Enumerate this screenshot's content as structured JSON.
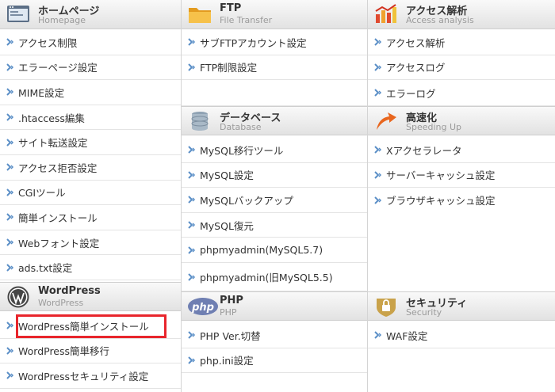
{
  "columns": [
    {
      "sections": [
        {
          "title": "ホームページ",
          "subtitle": "Homepage",
          "icon": "homepage-icon",
          "items": [
            "アクセス制限",
            "エラーページ設定",
            "MIME設定",
            ".htaccess編集",
            "サイト転送設定",
            "アクセス拒否設定",
            "CGIツール",
            "簡単インストール",
            "Webフォント設定",
            "ads.txt設定"
          ]
        },
        {
          "title": "WordPress",
          "subtitle": "WordPress",
          "icon": "wordpress-icon",
          "items": [
            "WordPress簡単インストール",
            "WordPress簡単移行",
            "WordPressセキュリティ設定"
          ]
        }
      ]
    },
    {
      "sections": [
        {
          "title": "FTP",
          "subtitle": "File Transfer",
          "icon": "folder-icon",
          "items": [
            "サブFTPアカウント設定",
            "FTP制限設定"
          ]
        },
        {
          "title": "データベース",
          "subtitle": "Database",
          "icon": "database-icon",
          "items": [
            "MySQL移行ツール",
            "MySQL設定",
            "MySQLバックアップ",
            "MySQL復元",
            "phpmyadmin(MySQL5.7)",
            "phpmyadmin(旧MySQL5.5)"
          ]
        },
        {
          "title": "PHP",
          "subtitle": "PHP",
          "icon": "php-icon",
          "items": [
            "PHP Ver.切替",
            "php.ini設定"
          ]
        }
      ]
    },
    {
      "sections": [
        {
          "title": "アクセス解析",
          "subtitle": "Access analysis",
          "icon": "access-analysis-icon",
          "items": [
            "アクセス解析",
            "アクセスログ",
            "エラーログ"
          ]
        },
        {
          "title": "高速化",
          "subtitle": "Speeding Up",
          "icon": "speed-up-arrow-icon",
          "items": [
            "Xアクセラレータ",
            "サーバーキャッシュ設定",
            "ブラウザキャッシュ設定"
          ]
        },
        {
          "title": "セキュリティ",
          "subtitle": "Security",
          "icon": "security-lock-icon",
          "items": [
            "WAF設定"
          ]
        }
      ]
    }
  ],
  "highlighted_item": "WordPress簡単インストール",
  "colors": {
    "highlight": "#e8252c",
    "arrow": "#5b8fc7",
    "header_bg": "#e9e9e9"
  }
}
